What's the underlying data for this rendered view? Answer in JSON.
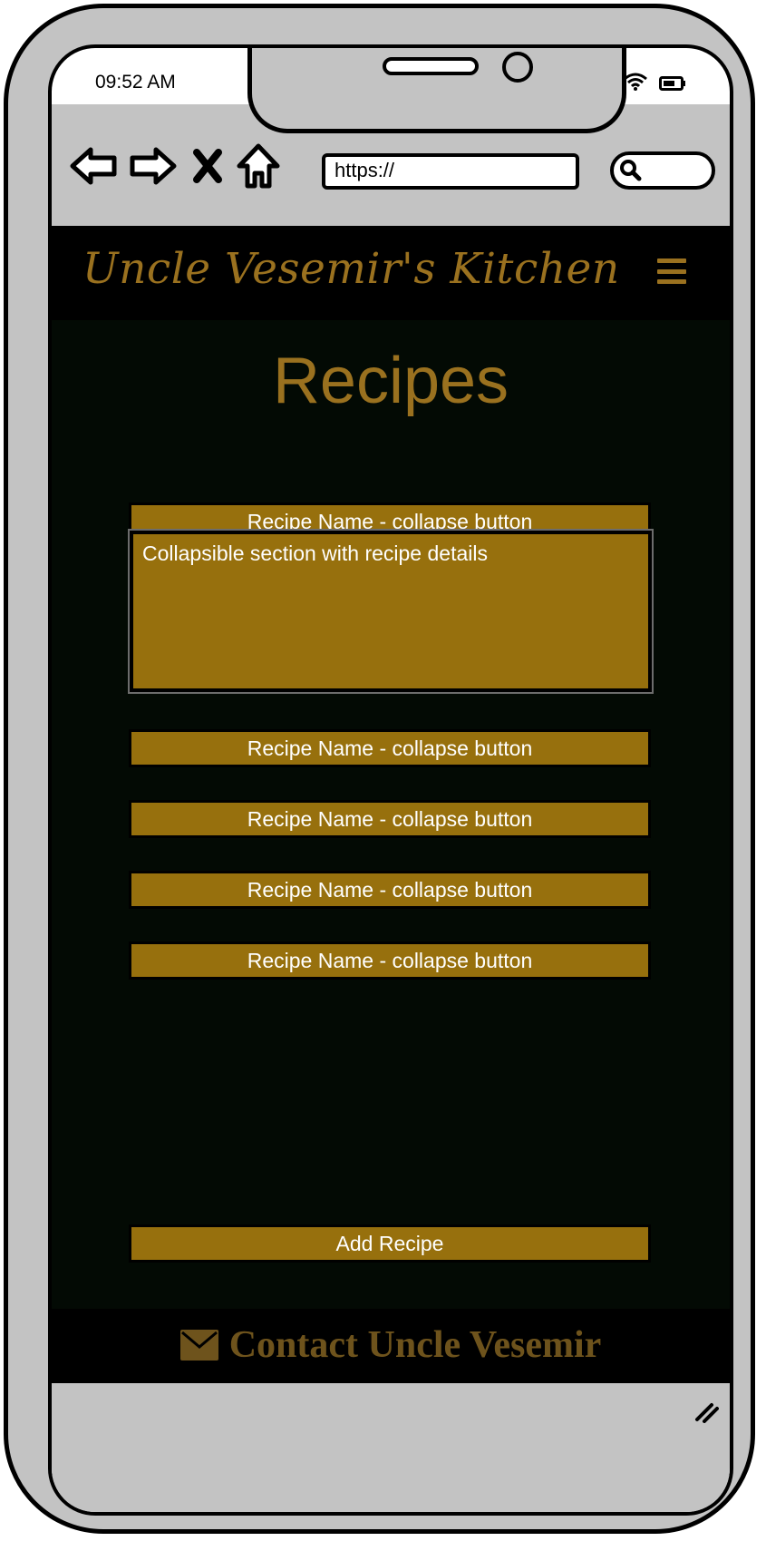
{
  "status_bar": {
    "time": "09:52 AM"
  },
  "browser": {
    "title": "Uncle Vesemirs Kitchen",
    "url": "https://",
    "icons": [
      "back-arrow-icon",
      "forward-arrow-icon",
      "close-icon",
      "home-icon",
      "search-icon"
    ]
  },
  "header": {
    "site_title": "Uncle Vesemir's Kitchen",
    "menu_icon": "hamburger-menu-icon"
  },
  "main": {
    "title": "Recipes",
    "recipes": [
      {
        "label": "Recipe Name - collapse button",
        "expanded": true,
        "details": "Collapsible section with recipe details"
      },
      {
        "label": "Recipe Name - collapse button",
        "expanded": false
      },
      {
        "label": "Recipe Name - collapse button",
        "expanded": false
      },
      {
        "label": "Recipe Name - collapse button",
        "expanded": false
      },
      {
        "label": "Recipe Name - collapse button",
        "expanded": false
      }
    ],
    "add_button": "Add Recipe"
  },
  "footer": {
    "contact_label": "Contact Uncle Vesemir",
    "contact_icon": "envelope-icon"
  },
  "colors": {
    "accent": "#97700d",
    "page_background": "#030a04",
    "header_background": "#000000",
    "chrome": "#c3c3c3"
  }
}
